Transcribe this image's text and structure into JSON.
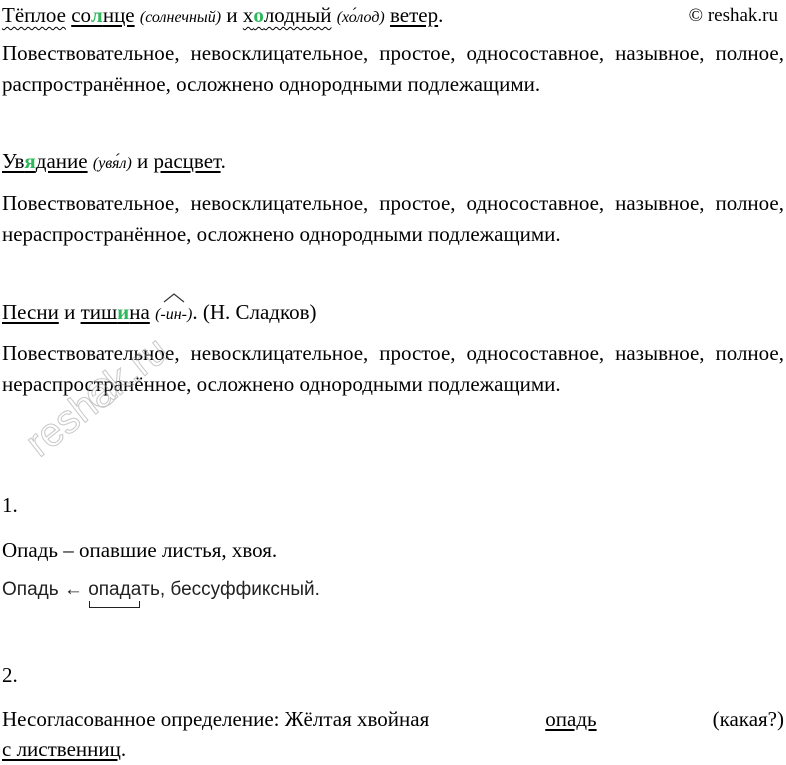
{
  "site": "© reshak.ru",
  "watermark": "reshak.ru",
  "s1": {
    "w1": "Тёплое",
    "w2a": "со",
    "w2b": "л",
    "w2c": "нце",
    "n1": "(солнечный)",
    "c1": "и",
    "w3a": "х",
    "w3b": "о",
    "w3c": "лодный",
    "n2": "(хо́лод)",
    "w4": "ветер",
    "end": "."
  },
  "d1": "Повествовательное, невосклицательное, простое, односоставное, назывное, полное, распространённое, осложнено однородными подлежащими.",
  "s2": {
    "w1a": "Ув",
    "w1b": "я",
    "w1c": "дание",
    "n1": "(увя́л)",
    "c1": "и",
    "w2": "расцвет",
    "end": "."
  },
  "d2": "Повествовательное, невосклицательное, простое, односоставное, назывное, полное, нераспространённое, осложнено однородными подлежащими.",
  "s3": {
    "w1": "Песни",
    "c1": "и",
    "w2a": "тиш",
    "w2b": "и",
    "w2c": "на",
    "n1": "(-ин-)",
    "end": ". (Н. Сладков)"
  },
  "d3": "Повествовательное, невосклицательное, простое, односоставное, назывное, полное, нераспространённое, осложнено однородными подлежащими.",
  "t1": {
    "num": "1.",
    "def": "Опадь – опавшие листья, хвоя.",
    "p1": "Опадь ←",
    "p2a": "опада",
    "p2b": "ть",
    "p3": ", бессуффиксный."
  },
  "t2": {
    "num": "2.",
    "line1a": "Несогласованное определение: Жёлтая хвойная",
    "line1b": "опадь",
    "line1c": "(какая?)",
    "line2": "с лиственниц",
    "end": "."
  }
}
